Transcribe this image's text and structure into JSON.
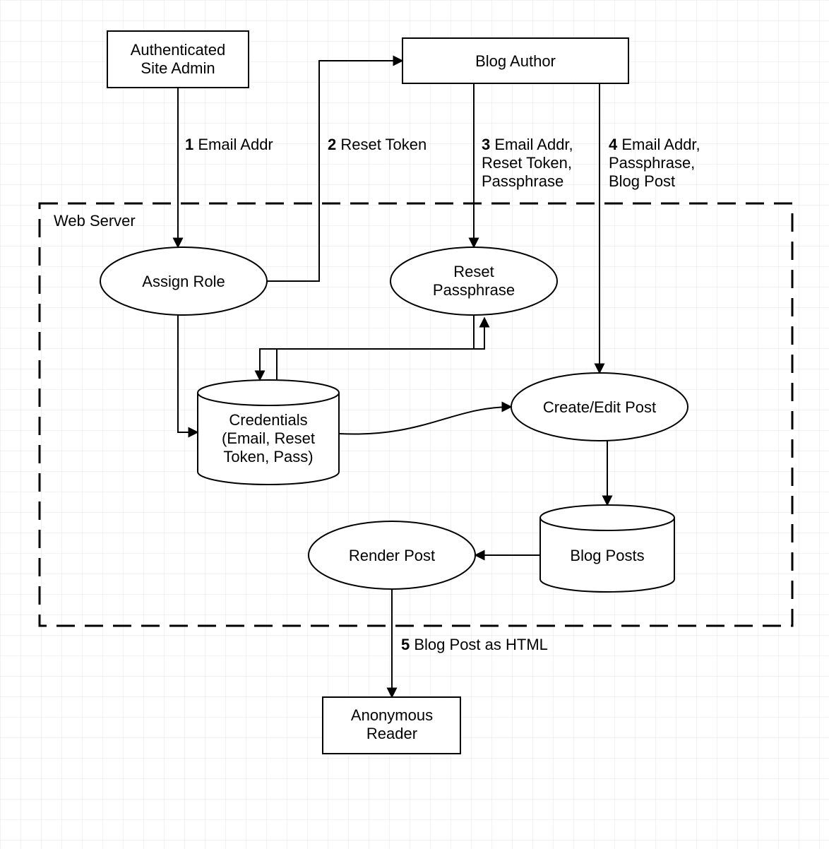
{
  "container_label": "Web Server",
  "actors": {
    "admin": {
      "line1": "Authenticated",
      "line2": "Site Admin"
    },
    "author": {
      "line1": "Blog Author"
    },
    "reader": {
      "line1": "Anonymous",
      "line2": "Reader"
    }
  },
  "processes": {
    "assign_role": "Assign Role",
    "reset_pass": {
      "line1": "Reset",
      "line2": "Passphrase"
    },
    "create_edit": "Create/Edit Post",
    "render_post": "Render Post"
  },
  "stores": {
    "credentials": {
      "line1": "Credentials",
      "line2": "(Email, Reset",
      "line3": "Token, Pass)"
    },
    "blog_posts": "Blog Posts"
  },
  "flows": {
    "f1": {
      "num": "1",
      "text": "Email Addr"
    },
    "f2": {
      "num": "2",
      "text": "Reset Token"
    },
    "f3": {
      "num": "3",
      "line1": "Email Addr,",
      "line2": "Reset Token,",
      "line3": "Passphrase"
    },
    "f4": {
      "num": "4",
      "line1": "Email Addr,",
      "line2": "Passphrase,",
      "line3": "Blog Post"
    },
    "f5": {
      "num": "5",
      "text": "Blog Post as HTML"
    }
  },
  "chart_data": {
    "type": "dataflow-diagram",
    "external_entities": [
      "Authenticated Site Admin",
      "Blog Author",
      "Anonymous Reader"
    ],
    "processes": [
      "Assign Role",
      "Reset Passphrase",
      "Create/Edit Post",
      "Render Post"
    ],
    "data_stores": [
      "Credentials (Email, Reset Token, Pass)",
      "Blog Posts"
    ],
    "trust_boundary": "Web Server",
    "flows": [
      {
        "id": 1,
        "from": "Authenticated Site Admin",
        "to": "Assign Role",
        "data": "Email Addr"
      },
      {
        "id": 2,
        "from": "Assign Role",
        "to": "Blog Author",
        "data": "Reset Token"
      },
      {
        "id": 3,
        "from": "Blog Author",
        "to": "Reset Passphrase",
        "data": "Email Addr, Reset Token, Passphrase"
      },
      {
        "id": 4,
        "from": "Blog Author",
        "to": "Create/Edit Post",
        "data": "Email Addr, Passphrase, Blog Post"
      },
      {
        "id": 5,
        "from": "Render Post",
        "to": "Anonymous Reader",
        "data": "Blog Post as HTML"
      },
      {
        "from": "Assign Role",
        "to": "Credentials (Email, Reset Token, Pass)",
        "data": ""
      },
      {
        "from": "Reset Passphrase",
        "to": "Credentials (Email, Reset Token, Pass)",
        "data": ""
      },
      {
        "from": "Credentials (Email, Reset Token, Pass)",
        "to": "Reset Passphrase",
        "data": ""
      },
      {
        "from": "Credentials (Email, Reset Token, Pass)",
        "to": "Create/Edit Post",
        "data": ""
      },
      {
        "from": "Create/Edit Post",
        "to": "Blog Posts",
        "data": ""
      },
      {
        "from": "Blog Posts",
        "to": "Render Post",
        "data": ""
      }
    ]
  }
}
